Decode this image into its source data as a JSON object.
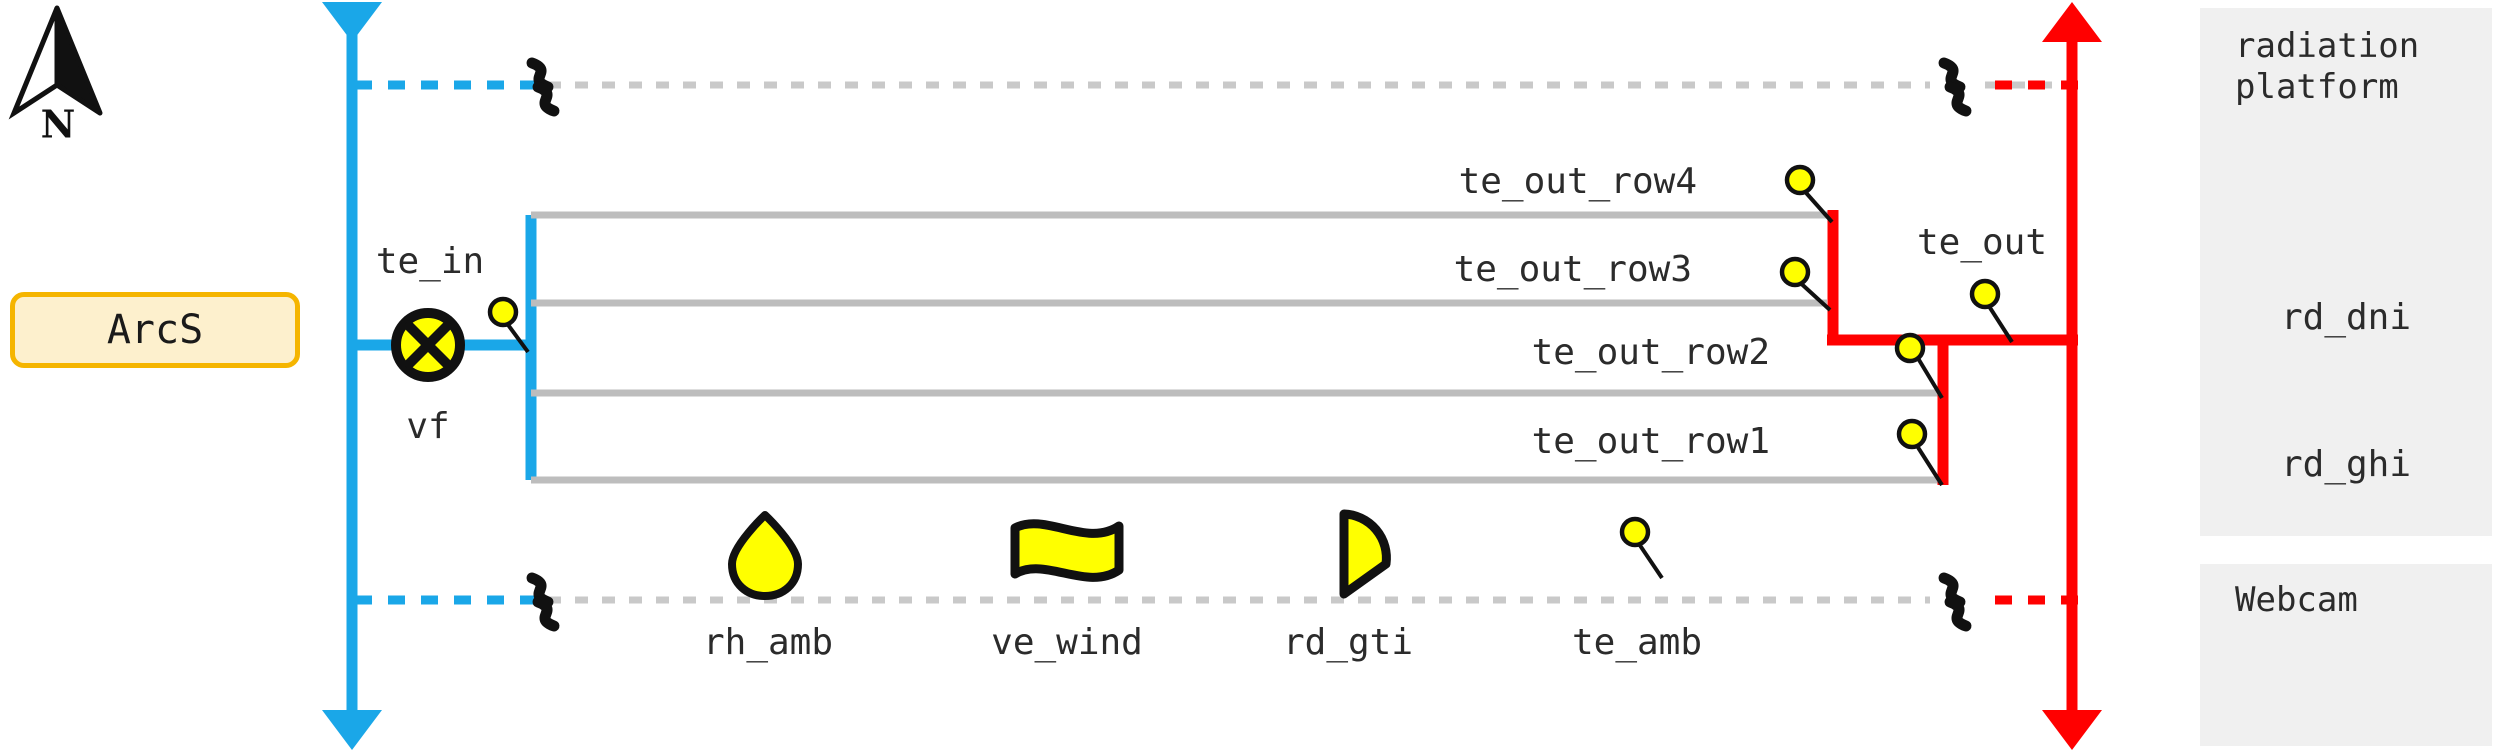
{
  "diagram": {
    "title": "solar thermal loop instrumentation diagram",
    "compass": {
      "label": "N",
      "icon": "north-arrow-icon"
    },
    "plant_box": {
      "label": "ArcS"
    },
    "inlet": {
      "pipe_color": "#1aa7e8",
      "sensor_label": "te_in",
      "valve_label": "vf",
      "valve_icon": "valve-cross-circle-icon"
    },
    "outlet": {
      "pipe_color": "#ff0000",
      "sensor_label": "te_out"
    },
    "rows": [
      {
        "label": "te_out_row4",
        "sensor": "te_out_row4"
      },
      {
        "label": "te_out_row3",
        "sensor": "te_out_row3"
      },
      {
        "label": "te_out_row2",
        "sensor": "te_out_row2"
      },
      {
        "label": "te_out_row1",
        "sensor": "te_out_row1"
      }
    ],
    "ambient_sensors": [
      {
        "label": "rh_amb",
        "icon": "droplet-icon"
      },
      {
        "label": "ve_wind",
        "icon": "wavy-flag-icon"
      },
      {
        "label": "rd_gti",
        "icon": "tilted-pie-icon"
      },
      {
        "label": "te_amb",
        "icon": "pin-dot-icon"
      }
    ],
    "legend_panels": [
      {
        "title": "radiation\nplatform",
        "items": [
          {
            "label": "rd_dni",
            "icon": "tilted-bar-icon"
          },
          {
            "label": "rd_ghi",
            "icon": "dome-icon"
          }
        ]
      },
      {
        "title": "Webcam",
        "items": [
          {
            "label": "",
            "icon": "webcam-icon"
          }
        ]
      }
    ],
    "colors": {
      "cold_pipe": "#1aa7e8",
      "hot_pipe": "#ff0000",
      "sensor_fill": "#ffff00",
      "row_line": "#bdbdbd",
      "panel_bg": "#f0f0f0",
      "box_fill": "#fdf0cd",
      "box_border": "#f5b500",
      "text": "#2b2b2b"
    }
  }
}
